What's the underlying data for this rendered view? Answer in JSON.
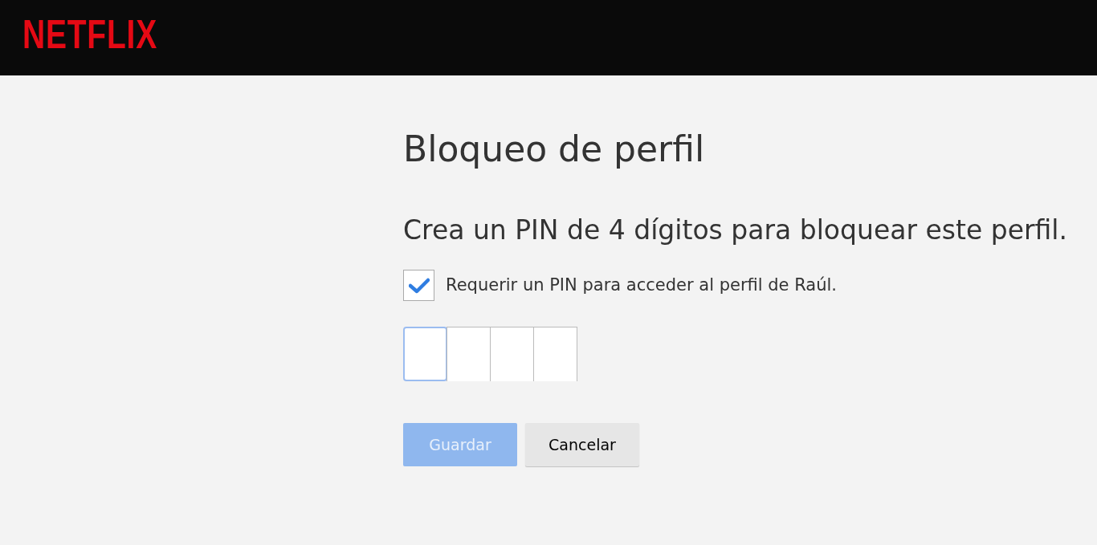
{
  "header": {
    "logo": "NETFLIX"
  },
  "title": "Bloqueo de perfil",
  "subtitle": "Crea un PIN de 4 dígitos para bloquear este perfil.",
  "require_pin": {
    "label": "Requerir un PIN para acceder al perfil de Raúl.",
    "checked": true
  },
  "pin_digits": [
    {
      "focused": true
    },
    {
      "focused": false
    },
    {
      "focused": false
    },
    {
      "focused": false
    }
  ],
  "buttons": [
    {
      "label": "Guardar",
      "kind": "primary",
      "disabled": true
    },
    {
      "label": "Cancelar",
      "kind": "secondary",
      "disabled": false
    }
  ]
}
